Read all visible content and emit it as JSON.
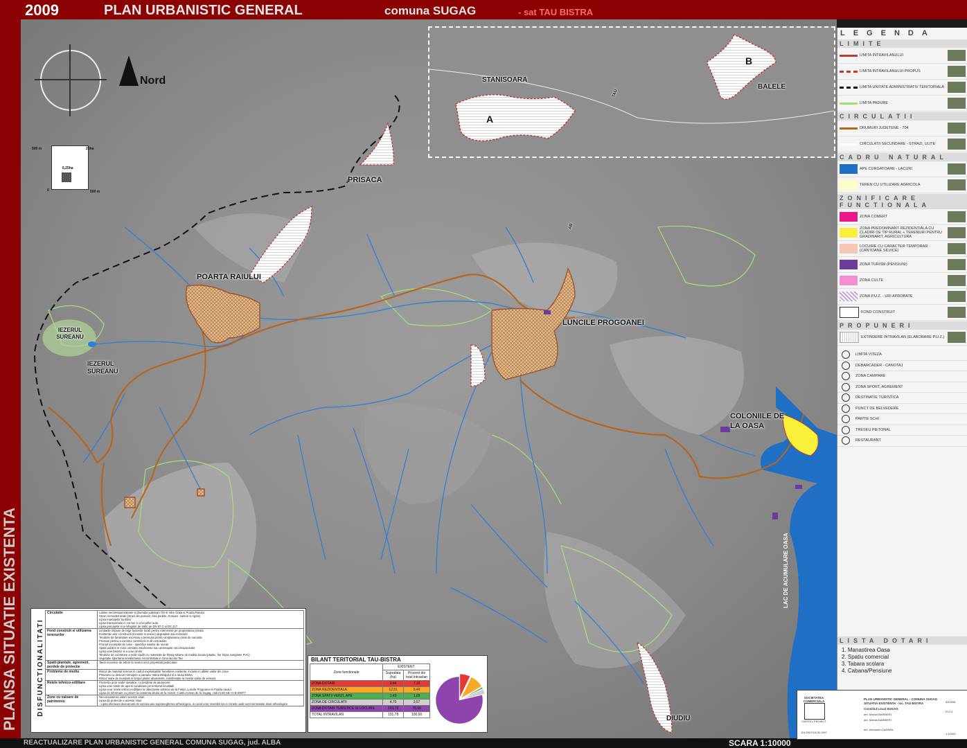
{
  "header": {
    "year": "2009",
    "title_main": "PLAN URBANISTIC GENERAL",
    "title_commune": "comuna SUGAG",
    "title_village": "- sat TAU BISTRA",
    "side_text": "PLANSA SITUATIE EXISTENTA",
    "footer_left": "REACTUALIZARE PLAN URBANISTIC GENERAL COMUNA SUGAG, jud. ALBA",
    "scale": "SCARA 1:10000"
  },
  "north": {
    "label": "Nord"
  },
  "scale_box": {
    "top_left": "500 m",
    "top_right": "25ha",
    "inner": "6,25ha",
    "bottom_right": "500 m",
    "zero": "0"
  },
  "places": {
    "stanisoara": "STANISOARA",
    "balele": "BALELE",
    "a": "A",
    "b": "B",
    "prisaca": "PRISACA",
    "poarta_raiului": "POARTA RAIULUI",
    "luncile_progoanei": "LUNCILE PROGOANEI",
    "coloniile_oasa": "COLONIILE DE LA OASA",
    "iezerul_sureanu_lake": "IEZERUL SUREANU",
    "iezerul_sureanu_village": "IEZERUL SUREANU",
    "diudiu": "DIUDIU",
    "lac_oasa": "LAC DE ACUMULARE OASA",
    "road_tau": "TAU",
    "road_ab": "AB"
  },
  "legend": {
    "title": "LEGENDA",
    "sections": [
      {
        "head": "LIMITE",
        "items": [
          {
            "label": "LIMITA INTRAVILANULUI",
            "color": "#c0392b",
            "style": "solid"
          },
          {
            "label": "LIMITA INTRAVILANULUI PROPUS",
            "color": "#c0392b",
            "style": "dashed"
          },
          {
            "label": "LIMITA UNITATE ADMINISTRATIV TERITORIALA",
            "color": "#111111",
            "style": "dashed"
          },
          {
            "label": "LIMITA PADURE",
            "color": "#9be36a",
            "style": "solid"
          }
        ]
      },
      {
        "head": "CIRCULATII",
        "items": [
          {
            "label": "DRUMURI JUDETENE - 704",
            "color": "#b5651d",
            "style": "solid"
          },
          {
            "label": "CIRCULATII SECUNDARE - STRAZI, ULITE",
            "color": "#ffffff",
            "style": "solid"
          }
        ]
      },
      {
        "head": "CADRU NATURAL",
        "items": [
          {
            "label": "APE CURGATOARE - LACURI",
            "color": "#1f6fc4",
            "style": "fill"
          },
          {
            "label": "TEREN CU UTILIZARE AGRICOLA",
            "color": "#fdfdc8",
            "style": "fill"
          }
        ]
      },
      {
        "head": "ZONIFICARE FUNCTIONALA",
        "items": [
          {
            "label": "ZONA COMERT",
            "color": "#e8188b",
            "style": "fill"
          },
          {
            "label": "ZONA PREDOMINANT REZIDENTIALA CU CLADIRI DE TIP RURAL + TERENURI PENTRU GRADINARIT, AGRICULTURA",
            "color": "#f9f03a",
            "style": "fill"
          },
          {
            "label": "LOCUIRE CU CARACTER TEMPORAR (CANTOANE SILVICE)",
            "color": "#f6c8b6",
            "style": "fill"
          },
          {
            "label": "ZONA TURISM (PENSIUNI)",
            "color": "#6a3d9a",
            "style": "fill"
          },
          {
            "label": "ZONA CULTE",
            "color": "#f38fd0",
            "style": "fill"
          },
          {
            "label": "ZONA P.U.Z. - URI APROBATE",
            "color": "#c9a0dc",
            "style": "hatch"
          },
          {
            "label": "FOND CONSTRUIT",
            "color": "#333333",
            "style": "icon"
          }
        ]
      },
      {
        "head": "PROPUNERI",
        "items": [
          {
            "label": "EXTINDERE INTRAVILAN (ELABORARE P.U.Z.)",
            "color": "#ffffff",
            "style": "stripe"
          }
        ]
      }
    ],
    "symbols": [
      "LIMITA VITEZA",
      "DEBARCADER - CANOTAJ",
      "ZONA CAMPARE",
      "ZONA SPORT, AGREMENT",
      "DESTINATIE TURISTICA",
      "PUNCT DE BELVEDERE",
      "PARTIE SCHI",
      "TRESEU PIETONAL",
      "RESTAURANT"
    ]
  },
  "lista_dotari": {
    "title": "LISTA DOTARI",
    "items": [
      "1. Manastirea Oasa",
      "2. Spatiu comercial",
      "3. Tabara scolara",
      "4. Cabana/Pensiune"
    ]
  },
  "disfunctionalitati": {
    "vertical_title": "DISFUNCTIONALITATI",
    "rows": [
      {
        "cat": "Circulatie",
        "lines": [
          "Latime necorespunzatoare a drumului judetean 704 E intre Oasa si Poarta Raiului",
          "Strazi nemodernizate (strazi din pamant, fara podete, trotuare, santuri si rigole)",
          "Lipsa marcajelor turistice",
          "Lipsa transportului in comun si a locurilor auto.",
          "Lipsa parcajelor si a refugiilor de trafic pe DN 67 C si DC 217"
        ]
      },
      {
        "cat": "Fond construit si utilizarea terenurilor",
        "lines": [
          "Limitarile impuse de lege factorilor locali pentru interventie pe proprietatea privata",
          "Existenta unor constructii (locuinte si anexe) degradate sau nelocuite",
          "Tendinte de faramitare excesiva a terenului pentru amplasarea casei de vacanta",
          "Presiuni pentru a construi constructii in din extravilan",
          "Frontul incomplet de case - specifice satelor de munte",
          "Spatii publice in zona centrala insuficiente sau amenajate necorespunzator",
          "Lipsa unei biserici si a unui cimitir",
          "Tendinte de construire a noile cladiri cu materiale de finisaj straine de traditia locala (plastic, fier forjat, tamplarie PVC)",
          "Vegetatie spontana nevaloroasa, necontrolata in zona lacului Tau"
        ]
      },
      {
        "cat": "Spatii plantate, agrement, perdele de protectie",
        "lines": [
          "Taieri excesive de arbori la nivelul unor proprietati particulare"
        ]
      },
      {
        "cat": "Probleme de mediu",
        "lines": [
          "Riscul de material lemnos in cadrul exploatatiilor forestiere existente, inclusiv in albiile vailor din zona",
          "Poluarea cu deseuri menajere a paraului Valea Mirajului si a raului Bistra",
          "Riscul mare de inundatii in timpul ploilor abundente, manifestate la nivelul vailor de versant"
        ]
      },
      {
        "cat": "Retele tehnico-edilitare",
        "lines": [
          "Prezenta unor sodiri metalice, cu tendinte de alunecare",
          "Lipsa unei retele de apa si canalizare pe teritoriul localitatii",
          "Lipsa unor retele tehnico-edilitare la obiectivele turistice de la Fetita, Luncile Progoanei si Poarta raiului",
          "Lipsa de informare cu privire la existenta sitului de la Auseri, Castru roman de la Sugag, codul LMI AB-I-s-B-00077"
        ]
      },
      {
        "cat": "Zone cu valoare de patrimoniu",
        "lines": [
          "Necunoasterea valorii acestor situri",
          "Lipsa de protectie a acestor situri",
          "- Lipsa efectuarii descarcarii de sarcina asu supravegherea arheologica, in cazul unor investitii noi in zonele unde sunt semnalate situri arheologice"
        ]
      }
    ]
  },
  "bilant": {
    "title": "BILANT TERITORIAL TAU-BISTRA",
    "header_group": "EXISTENT",
    "col_zone": "Zone functionale",
    "col_area": "Suprafata (ha)",
    "col_pct": "Procent din total intravilan",
    "rows": [
      {
        "zone": "ZONA DOTARI",
        "area": "9,44",
        "pct": "7,16",
        "color": "#e53935"
      },
      {
        "zone": "ZONA REZIDENTIALA",
        "area": "12,51",
        "pct": "9,49",
        "color": "#f9a825"
      },
      {
        "zone": "ZONA SPATII VERZI, APE",
        "area": "1,43",
        "pct": "1,09",
        "color": "#4caf50"
      },
      {
        "zone": "ZONA DE CIRCULATII",
        "area": "4,70",
        "pct": "3,57",
        "color": "#cfcfcf"
      },
      {
        "zone": "ZONA DOTARI TURISTICE SI LOCUIRE",
        "area": "103,70",
        "pct": "78,69",
        "color": "#8e44ad"
      }
    ],
    "total": {
      "zone": "TOTAL INTRAVILAN",
      "area": "131,78",
      "pct": "100,00"
    }
  },
  "chart_data": {
    "type": "pie",
    "categories": [
      "ZONA DOTARI",
      "ZONA REZIDENTIALA",
      "ZONA SPATII VERZI, APE",
      "ZONA DE CIRCULATII",
      "ZONA DOTARI TURISTICE SI LOCUIRE"
    ],
    "values": [
      7.16,
      9.49,
      1.09,
      3.57,
      78.69
    ],
    "colors": [
      "#e53935",
      "#f9a825",
      "#4caf50",
      "#cfcfcf",
      "#8e44ad"
    ]
  },
  "titleblock": {
    "company": "SOCIETATEA COMERCIALA",
    "logo_text": "CAPITEL PROIECT",
    "reg": "J01/2007/15.05.1997",
    "project_title": "PLAN URBANISTIC GENERAL - COMUNA SUGAG",
    "subtitle": "SITUATIA EXISTENTA - loc. TAU BISTRA",
    "beneficiar": "Consiliul Local SUGAG",
    "sef_proiect": "arh. Marius BARBIERI",
    "proiectat": "arh. Marius BARBIERI",
    "desenat": "arh. Alexandru DAMIAN",
    "scara": "1:10000",
    "faza": "P.U.G.",
    "nr": "53/2008"
  }
}
